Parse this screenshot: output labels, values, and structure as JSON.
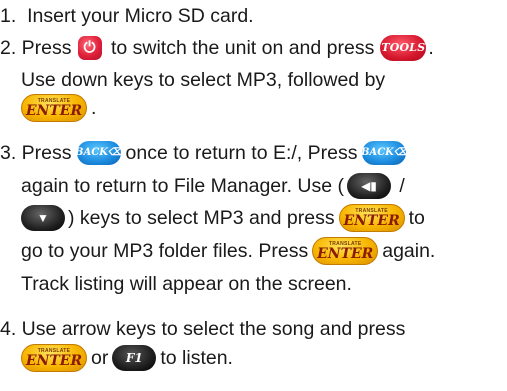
{
  "steps": {
    "s1": "1.  Insert your Micro SD card.",
    "s2_num": "2. Press",
    "s2_a": " to switch the unit on and press",
    "s2_b": ".",
    "s2_l2": "Use down keys to select MP3, followed by",
    "s2_l3": ".",
    "s3_num": "3. Press",
    "s3_a": "once to return to E:/, Press",
    "s3_l2": "again to return to File Manager. Use (",
    "s3_l2b": " /",
    "s3_l3a": ") keys to select MP3 and press",
    "s3_l3b": "to",
    "s3_l4a": "go to your MP3 folder files. Press",
    "s3_l4b": "again.",
    "s3_l5": "Track listing will appear on the screen.",
    "s4_l1": "4. Use arrow keys to select the song and press",
    "s4_or": "or",
    "s4_end": "to listen."
  },
  "keys": {
    "power_glyph": "⏻",
    "tools": "TOOLS",
    "enter_small": "TRANSLATE",
    "enter_big": "ENTER",
    "back": "BACK⌫",
    "arrow_up_glyph": "◀▮",
    "arrow_down_glyph": "▼",
    "f1": "F1"
  },
  "colors": {
    "power": "#e0203a",
    "tools": "#d4162c",
    "enter": "#f7b500",
    "back": "#1e8ee0",
    "arrow": "#222222",
    "f1": "#1e1e1e",
    "text": "#1a1a1a"
  }
}
